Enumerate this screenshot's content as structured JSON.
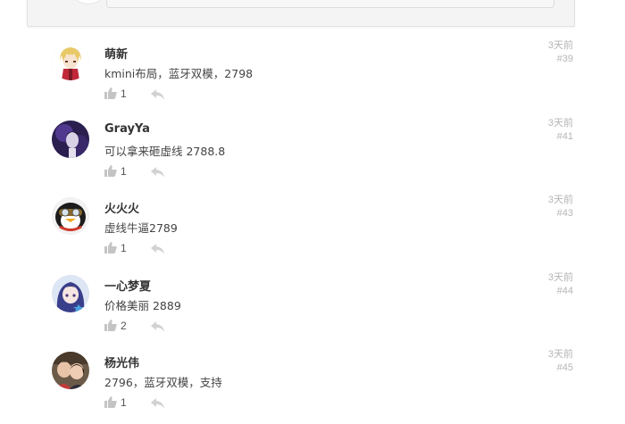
{
  "comments": [
    {
      "name": "萌新",
      "text": "kmini布局，蓝牙双模，2798",
      "likes": "1",
      "time": "3天前",
      "floor": "#39"
    },
    {
      "name": "GrayYa",
      "text": "可以拿来砸虚线 2788.8",
      "likes": "1",
      "time": "3天前",
      "floor": "#41"
    },
    {
      "name": "火火火",
      "text": "虚线牛逼2789",
      "likes": "1",
      "time": "3天前",
      "floor": "#43"
    },
    {
      "name": "一心梦夏",
      "text": "价格美丽 2889",
      "likes": "2",
      "time": "3天前",
      "floor": "#44"
    },
    {
      "name": "杨光伟",
      "text": "2796，蓝牙双模，支持",
      "likes": "1",
      "time": "3天前",
      "floor": "#45"
    }
  ],
  "icons": {
    "like": "thumbs-up-icon",
    "reply": "reply-arrow-icon"
  },
  "colors": {
    "meta": "#b5b5b5",
    "icon": "#c4c4c4",
    "name": "#333333"
  }
}
